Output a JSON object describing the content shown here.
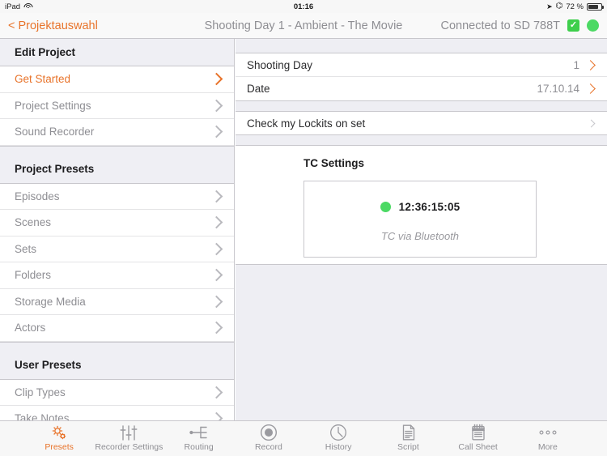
{
  "statusbar": {
    "device": "iPad",
    "wifi_icon": "wifi-icon",
    "time": "01:16",
    "location_icon": "location-arrow-icon",
    "bluetooth_icon": "bluetooth-icon",
    "battery_percent": "72 %",
    "battery_icon": "battery-icon"
  },
  "navbar": {
    "back_label": "< Projektauswahl",
    "title": "Shooting Day 1 - Ambient - The Movie",
    "connection_label": "Connected to SD 788T",
    "check_icon": "checkmark-box-icon",
    "status_dot": "green-status-dot"
  },
  "sidebar": {
    "sections": [
      {
        "title": "Edit Project",
        "items": [
          {
            "label": "Get Started",
            "active": true
          },
          {
            "label": "Project Settings",
            "active": false
          },
          {
            "label": "Sound Recorder",
            "active": false
          }
        ]
      },
      {
        "title": "Project Presets",
        "items": [
          {
            "label": "Episodes",
            "active": false
          },
          {
            "label": "Scenes",
            "active": false
          },
          {
            "label": "Sets",
            "active": false
          },
          {
            "label": "Folders",
            "active": false
          },
          {
            "label": "Storage Media",
            "active": false
          },
          {
            "label": "Actors",
            "active": false
          }
        ]
      },
      {
        "title": "User Presets",
        "items": [
          {
            "label": "Clip Types",
            "active": false
          },
          {
            "label": "Take Notes",
            "active": false
          }
        ]
      }
    ]
  },
  "detail": {
    "rows": [
      {
        "label": "Shooting Day",
        "value": "1"
      },
      {
        "label": "Date",
        "value": "17.10.14"
      }
    ],
    "lockits_label": "Check my Lockits on set",
    "tc": {
      "title": "TC Settings",
      "timecode": "12:36:15:05",
      "source": "TC via Bluetooth",
      "dot": "green-status-dot"
    }
  },
  "tabbar": {
    "tabs": [
      {
        "label": "Presets",
        "icon": "gears-icon",
        "active": true
      },
      {
        "label": "Recorder Settings",
        "icon": "sliders-icon",
        "active": false
      },
      {
        "label": "Routing",
        "icon": "routing-icon",
        "active": false
      },
      {
        "label": "Record",
        "icon": "record-icon",
        "active": false
      },
      {
        "label": "History",
        "icon": "clock-icon",
        "active": false
      },
      {
        "label": "Script",
        "icon": "document-icon",
        "active": false
      },
      {
        "label": "Call Sheet",
        "icon": "notepad-icon",
        "active": false
      },
      {
        "label": "More",
        "icon": "ellipsis-icon",
        "active": false
      }
    ]
  },
  "colors": {
    "accent": "#e8732a",
    "status_green": "#4cd964",
    "section_bg": "#efeff4"
  }
}
